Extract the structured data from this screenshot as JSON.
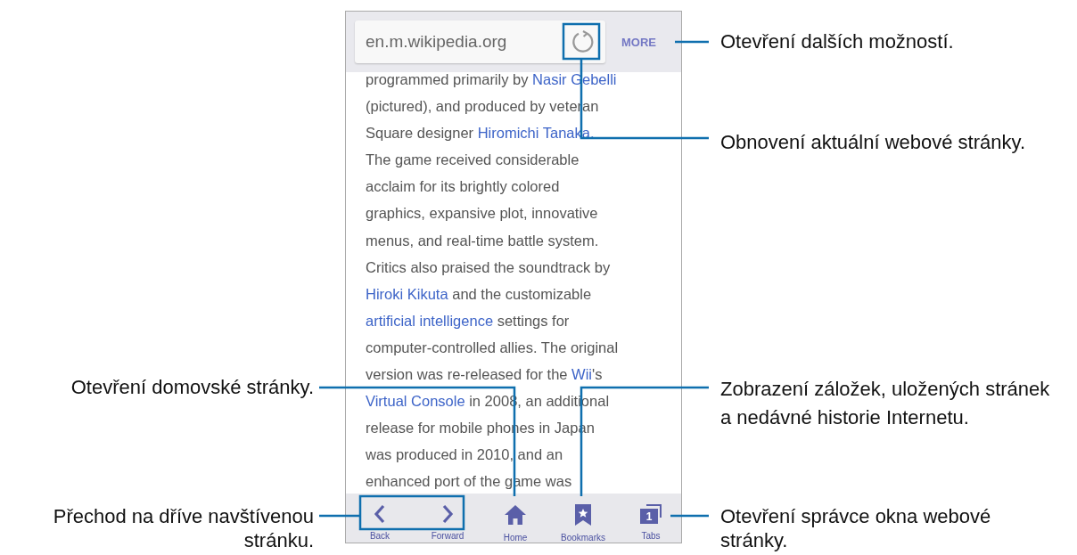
{
  "phone": {
    "address_bar": {
      "url": "en.m.wikipedia.org",
      "more": "MORE"
    },
    "article": [
      [
        {
          "text": "programmed primarily by ",
          "link": false
        },
        {
          "text": "Nasir Gebelli",
          "link": true
        }
      ],
      [
        {
          "text": "(pictured), and produced by veteran",
          "link": false
        }
      ],
      [
        {
          "text": "Square designer ",
          "link": false
        },
        {
          "text": "Hiromichi Tanaka.",
          "link": true
        }
      ],
      [
        {
          "text": "The game received considerable",
          "link": false
        }
      ],
      [
        {
          "text": "acclaim for its brightly colored",
          "link": false
        }
      ],
      [
        {
          "text": "graphics, expansive plot, innovative",
          "link": false
        }
      ],
      [
        {
          "text": "menus, and real-time battle system.",
          "link": false
        }
      ],
      [
        {
          "text": "Critics also praised the soundtrack by",
          "link": false
        }
      ],
      [
        {
          "text": "Hiroki Kikuta",
          "link": true
        },
        {
          "text": " and the customizable",
          "link": false
        }
      ],
      [
        {
          "text": "artificial intelligence",
          "link": true
        },
        {
          "text": " settings for",
          "link": false
        }
      ],
      [
        {
          "text": "computer-controlled allies. The original",
          "link": false
        }
      ],
      [
        {
          "text": "version was re-released for the ",
          "link": false
        },
        {
          "text": "Wii",
          "link": true
        },
        {
          "text": "'s",
          "link": false
        }
      ],
      [
        {
          "text": "Virtual Console",
          "link": true
        },
        {
          "text": " in 2008, an additional",
          "link": false
        }
      ],
      [
        {
          "text": "release for mobile phones in Japan",
          "link": false
        }
      ],
      [
        {
          "text": "was produced in 2010, and an",
          "link": false
        }
      ],
      [
        {
          "text": "enhanced port of the game was",
          "link": false
        }
      ]
    ],
    "toolbar": [
      {
        "kind": "back",
        "label": "Back"
      },
      {
        "kind": "forward",
        "label": "Forward"
      },
      {
        "kind": "home",
        "label": "Home"
      },
      {
        "kind": "bookmarks",
        "label": "Bookmarks"
      },
      {
        "kind": "tabs",
        "label": "Tabs",
        "count": "1"
      }
    ]
  },
  "callouts": [
    {
      "text": "Otevření dalších možností."
    },
    {
      "text": "Obnovení aktuální webové stránky."
    },
    {
      "text": "Otevření domovské stránky."
    },
    {
      "text": "Zobrazení záložek, uložených stránek a nedávné historie Internetu."
    },
    {
      "text": "Přechod na dříve navštívenou stránku."
    },
    {
      "text": "Otevření správce okna webové stránky."
    }
  ]
}
